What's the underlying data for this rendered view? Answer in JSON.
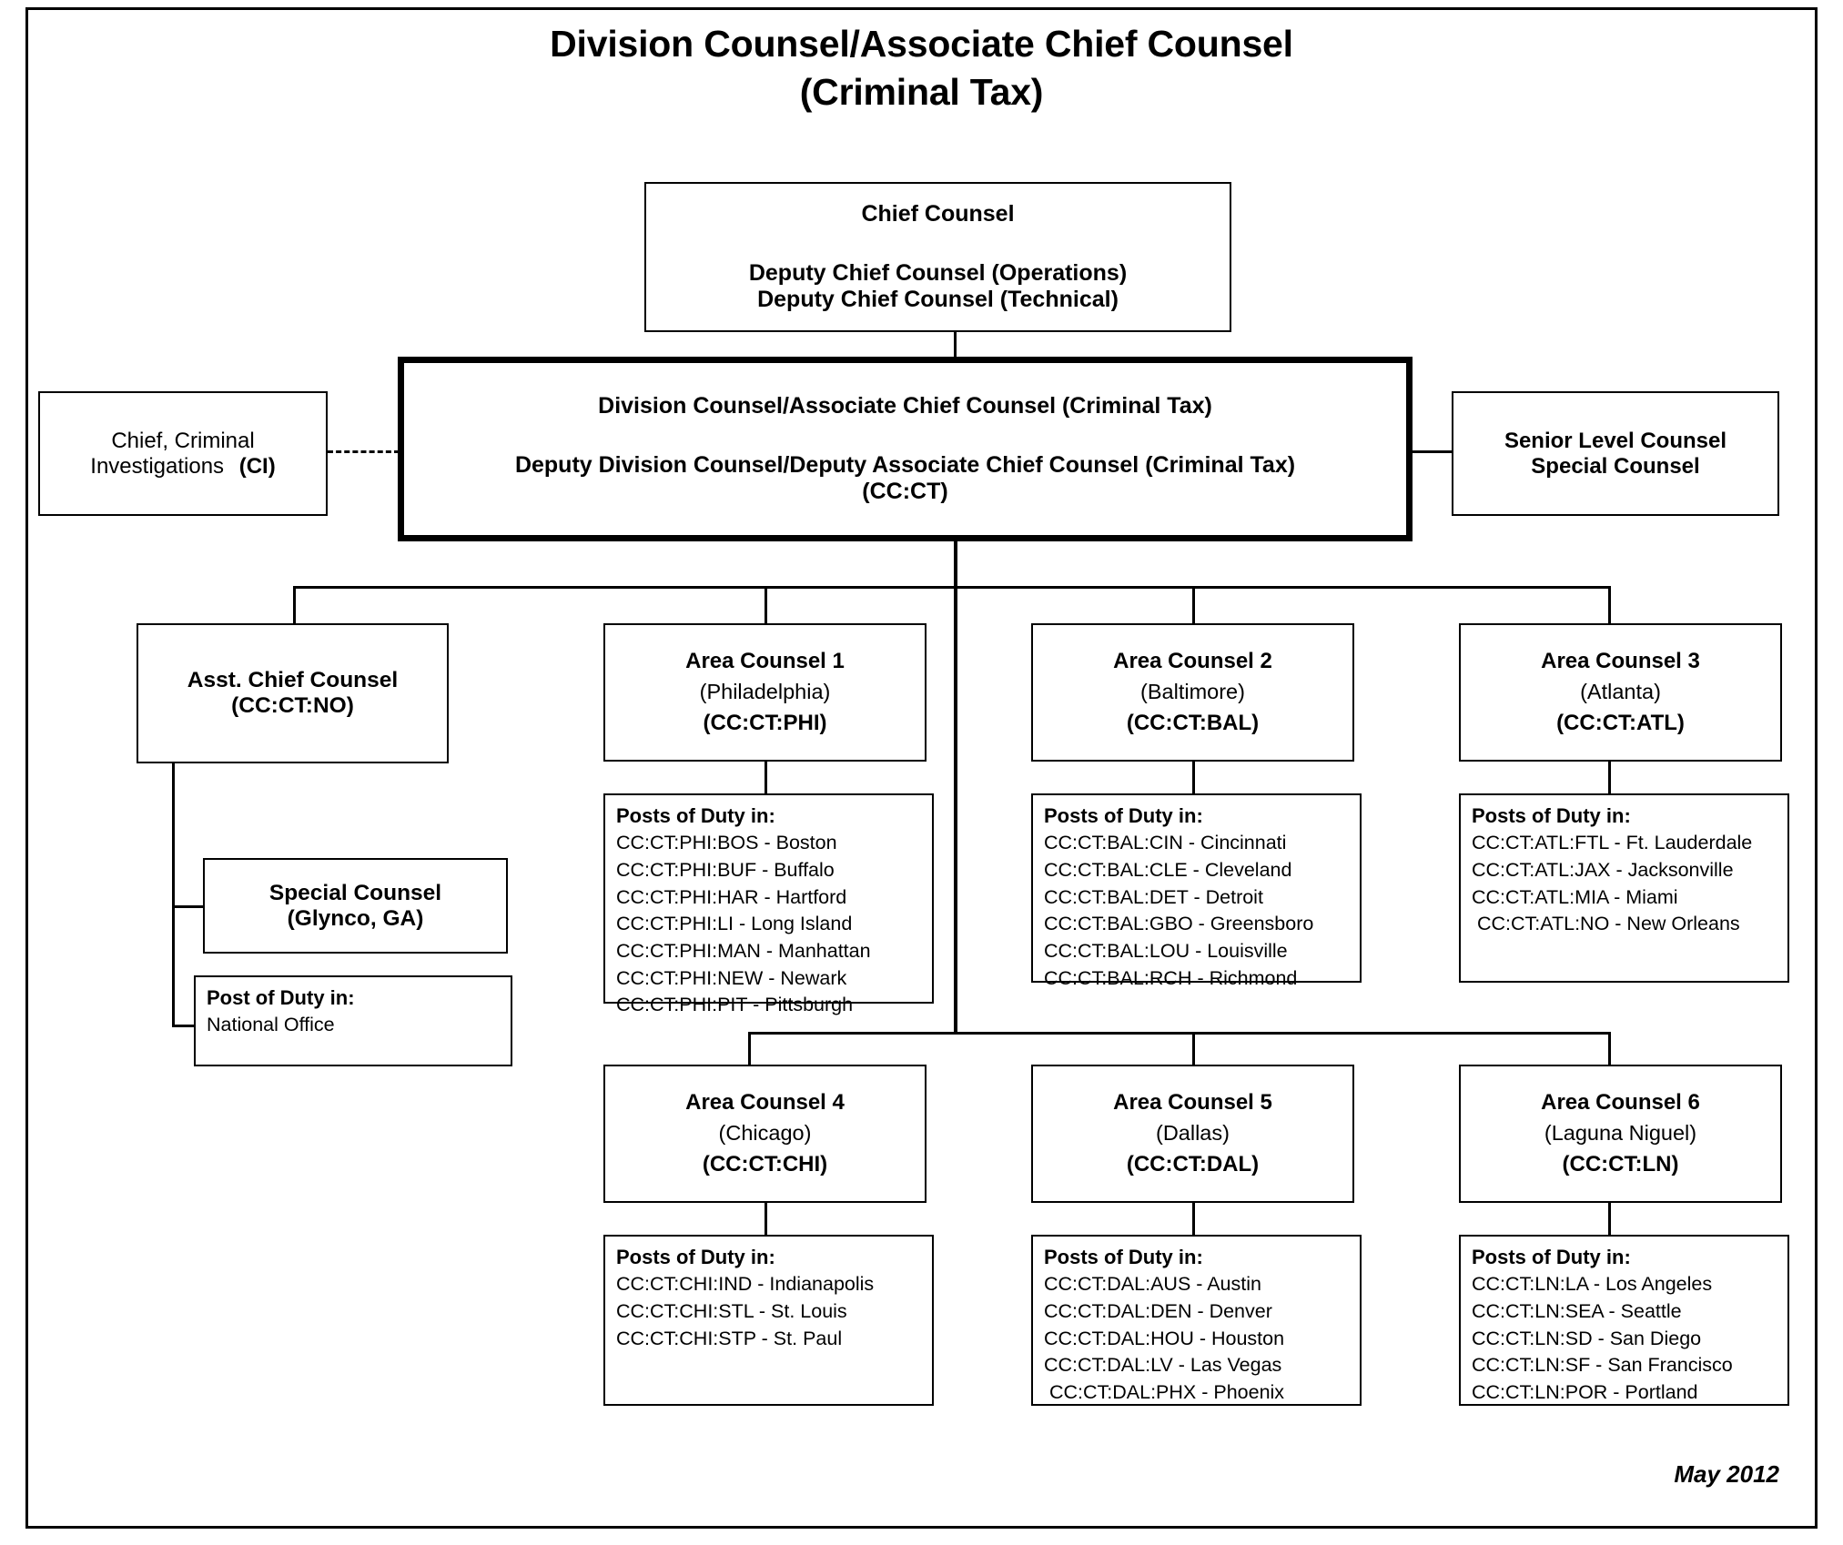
{
  "title": {
    "line1": "Division Counsel/Associate Chief Counsel",
    "line2": "(Criminal Tax)"
  },
  "chief_counsel_box": {
    "line1": "Chief Counsel",
    "line2": "Deputy Chief Counsel (Operations)",
    "line3": "Deputy Chief Counsel (Technical)"
  },
  "division_counsel_box": {
    "line1": "Division Counsel/Associate Chief Counsel (Criminal Tax)",
    "line2": "Deputy Division Counsel/Deputy Associate Chief Counsel (Criminal Tax)",
    "line3": "(CC:CT)"
  },
  "left_box": {
    "line1": "Chief, Criminal",
    "line2a": "Investigations",
    "line2b": "(CI)"
  },
  "right_box": {
    "line1": "Senior Level Counsel",
    "line2": "Special Counsel"
  },
  "asst_chief_counsel": {
    "line1": "Asst. Chief Counsel",
    "line2": "(CC:CT:NO)"
  },
  "special_counsel_glynco": {
    "line1": "Special Counsel",
    "line2": "(Glynco, GA)"
  },
  "national_office_pod": {
    "header": "Post of Duty in:",
    "items": [
      "National Office"
    ]
  },
  "posts_header": "Posts of Duty in:",
  "areas": [
    {
      "title": "Area Counsel 1",
      "city": "(Philadelphia)",
      "code": "(CC:CT:PHI)",
      "posts_header": "Posts of Duty in:",
      "posts": [
        "CC:CT:PHI:BOS - Boston",
        "CC:CT:PHI:BUF - Buffalo",
        "CC:CT:PHI:HAR - Hartford",
        "CC:CT:PHI:LI - Long Island",
        "CC:CT:PHI:MAN - Manhattan",
        "CC:CT:PHI:NEW - Newark",
        "CC:CT:PHI:PIT - Pittsburgh"
      ]
    },
    {
      "title": "Area Counsel 2",
      "city": "(Baltimore)",
      "code": "(CC:CT:BAL)",
      "posts_header": "Posts of Duty in:",
      "posts": [
        "CC:CT:BAL:CIN - Cincinnati",
        "CC:CT:BAL:CLE - Cleveland",
        "CC:CT:BAL:DET - Detroit",
        "CC:CT:BAL:GBO - Greensboro",
        "CC:CT:BAL:LOU - Louisville",
        "CC:CT:BAL:RCH - Richmond"
      ]
    },
    {
      "title": "Area Counsel 3",
      "city": "(Atlanta)",
      "code": "(CC:CT:ATL)",
      "posts_header": "Posts of Duty in:",
      "posts": [
        "CC:CT:ATL:FTL - Ft. Lauderdale",
        "CC:CT:ATL:JAX - Jacksonville",
        "CC:CT:ATL:MIA - Miami",
        " CC:CT:ATL:NO - New Orleans"
      ]
    },
    {
      "title": "Area Counsel 4",
      "city": "(Chicago)",
      "code": "(CC:CT:CHI)",
      "posts_header": "Posts of Duty in:",
      "posts": [
        "CC:CT:CHI:IND - Indianapolis",
        "CC:CT:CHI:STL - St. Louis",
        "CC:CT:CHI:STP - St. Paul"
      ]
    },
    {
      "title": "Area Counsel 5",
      "city": "(Dallas)",
      "code": "(CC:CT:DAL)",
      "posts_header": "Posts of Duty in:",
      "posts": [
        "CC:CT:DAL:AUS - Austin",
        "CC:CT:DAL:DEN - Denver",
        "CC:CT:DAL:HOU - Houston",
        "CC:CT:DAL:LV - Las Vegas",
        " CC:CT:DAL:PHX - Phoenix"
      ]
    },
    {
      "title": "Area Counsel 6",
      "city": "(Laguna Niguel)",
      "code": "(CC:CT:LN)",
      "posts_header": "Posts of Duty in:",
      "posts": [
        "CC:CT:LN:LA - Los Angeles",
        "CC:CT:LN:SEA - Seattle",
        "CC:CT:LN:SD - San Diego",
        "CC:CT:LN:SF - San Francisco",
        "CC:CT:LN:POR - Portland"
      ]
    }
  ],
  "footer": {
    "date": "May 2012"
  },
  "colors": {
    "ink": "#000000",
    "paper": "#ffffff"
  }
}
